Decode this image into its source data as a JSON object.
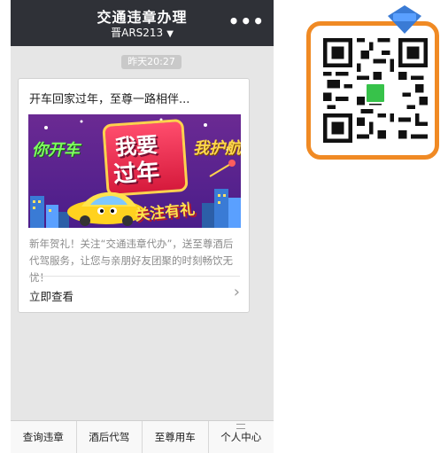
{
  "header": {
    "title": "交通违章办理",
    "account": "晋ARS213",
    "more_icon": "more-dots-icon"
  },
  "timestamp": "昨天20:27",
  "article": {
    "title": "开车回家过年，至尊一路相伴...",
    "banner": {
      "left_text": "你开车",
      "sign_text_1": "我要",
      "sign_text_2": "过年",
      "right_text": "我护航",
      "follow_text": "关注有礼"
    },
    "description": "新年贺礼！关注“交通违章代办”，送至尊酒后代驾服务，让您与亲朋好友团聚的时刻畅饮无忧！",
    "read_more": "立即查看"
  },
  "bottom_nav": {
    "items": [
      {
        "label": "查询违章"
      },
      {
        "label": "酒后代驾"
      },
      {
        "label": "至尊用车"
      },
      {
        "label": "个人中心"
      }
    ]
  },
  "colors": {
    "topbar": "#2f3137",
    "qr_border": "#f08a24",
    "qr_logo": "#37c24a"
  }
}
